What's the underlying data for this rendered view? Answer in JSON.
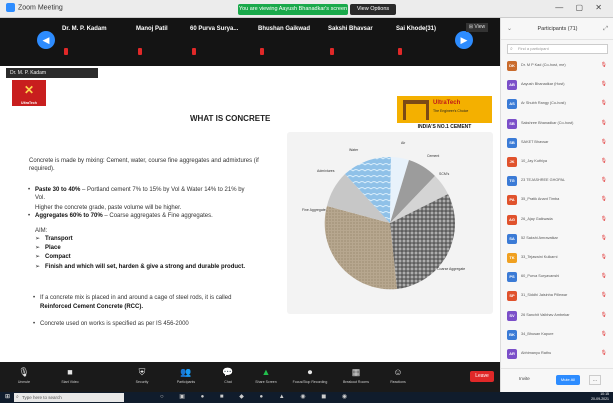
{
  "titlebar": {
    "app_name": "Zoom Meeting",
    "share_banner": "You are viewing Aayush Bhanadkar's screen",
    "stop_share": "View Options",
    "window_controls": "— ▢ ✕"
  },
  "strip": {
    "participants": [
      {
        "name": "Dr. M. P. Kadam"
      },
      {
        "name": "Manoj Patil"
      },
      {
        "name": "60 Purva Surya..."
      },
      {
        "name": "Bhushan Gaikwad"
      },
      {
        "name": "Sakshi Bhavsar"
      },
      {
        "name": "Sai Khode(31)"
      }
    ],
    "view_label": "⊞ View"
  },
  "slide": {
    "self_view": "Dr. M. P. Kadam",
    "left_logo_caption": "UltraTech",
    "title": "WHAT IS CONCRETE",
    "brand_name": "UltraTech",
    "brand_sub": "The Engineer's Choice",
    "brand_tag": "INDIA'S NO.1 CEMENT",
    "intro": "Concrete is made by mixing: Cement, water, course fine aggregates and admixtures (if required).",
    "paste_bold": "Paste 30 to 40%",
    "paste_rest": " – Portland cement 7% to 15% by Vol & Water 14% to 21% by Vol.",
    "paste_note": "Higher the concrete grade, paste volume will be higher.",
    "agg_bold": "Aggregates 60% to 70%",
    "agg_rest": " – Coarse aggregates & Fine aggregates.",
    "aim_label": "AIM:",
    "aims": [
      "Transport",
      "Place",
      "Compact"
    ],
    "finish_text": "Finish and which will set, harden & give a ",
    "finish_bold": "strong and durable product.",
    "rcc_text": "If a concrete mix is placed in and around a cage of steel rods, it is called",
    "rcc_bold": "Reinforced Cement Concrete (RCC).",
    "code_text": "Concrete used on works is specified as per IS 456-2000",
    "pie_labels": {
      "water": "Water",
      "air": "Air",
      "cement": "Cement",
      "scms": "SCM's",
      "admixtures": "Admixtures",
      "fine": "Fine Aggregate",
      "coarse": "Coarse Aggregate"
    }
  },
  "controls": [
    {
      "label": "Unmute",
      "icon": "mic-icon"
    },
    {
      "label": "Start Video",
      "icon": "video-icon"
    },
    {
      "label": "Security",
      "icon": "shield-icon"
    },
    {
      "label": "Participants",
      "icon": "participants-icon"
    },
    {
      "label": "Chat",
      "icon": "chat-icon"
    },
    {
      "label": "Share Screen",
      "icon": "share-icon"
    },
    {
      "label": "Focus/Stop Recording",
      "icon": "record-icon"
    },
    {
      "label": "Breakout Rooms",
      "icon": "breakout-icon"
    },
    {
      "label": "Reactions",
      "icon": "reactions-icon"
    }
  ],
  "end_label": "Leave",
  "panel": {
    "title": "Participants (71)",
    "search_placeholder": "Find a participant",
    "participants": [
      {
        "name": "Dr. M P Kad (Co-host, me)",
        "color": "#c96b2c",
        "initials": "DK"
      },
      {
        "name": "Aayush Bhanadkar (Host)",
        "color": "#7b4fc9",
        "initials": "AB"
      },
      {
        "name": "Ar Shubh Rangy (Co-host)",
        "color": "#3b7bd6",
        "initials": "AS"
      },
      {
        "name": "Sakshree Bhanadkar (Co-host)",
        "color": "#7b4fc9",
        "initials": "SB"
      },
      {
        "name": "SAKET Bhavsar",
        "color": "#3b7bd6",
        "initials": "SB"
      },
      {
        "name": "10_Jay Kuthiya",
        "color": "#e0522c",
        "initials": "JK"
      },
      {
        "name": "23 TEJASHREE GHOPAL",
        "color": "#3b7bd6",
        "initials": "TG"
      },
      {
        "name": "35_Pratik Anant Timba",
        "color": "#e0522c",
        "initials": "PA"
      },
      {
        "name": "26_Ajay Gaikwada",
        "color": "#e0522c",
        "initials": "AG"
      },
      {
        "name": "52 Sakshi Amravatkar",
        "color": "#3b7bd6",
        "initials": "SA"
      },
      {
        "name": "33_Tejaswini Kulkarni",
        "color": "#f0a020",
        "initials": "TK"
      },
      {
        "name": "60_Purva Suryavanshi",
        "color": "#3b7bd6",
        "initials": "PS"
      },
      {
        "name": "31_Siddhi Jaisinha Pillewar",
        "color": "#e0522c",
        "initials": "SP"
      },
      {
        "name": "26 Sanchit Vaibhav Ambekar",
        "color": "#7b4fc9",
        "initials": "SV"
      },
      {
        "name": "34_Bhusan Kapure",
        "color": "#3b7bd6",
        "initials": "BK"
      },
      {
        "name": "Abhimanyu Rathu",
        "color": "#7b4fc9",
        "initials": "AR"
      }
    ],
    "invite": "Invite",
    "mute_all": "Mute All",
    "more": "..."
  },
  "taskbar": {
    "search_placeholder": "Type here to search",
    "time": "10:15",
    "date": "20-09-2021"
  }
}
